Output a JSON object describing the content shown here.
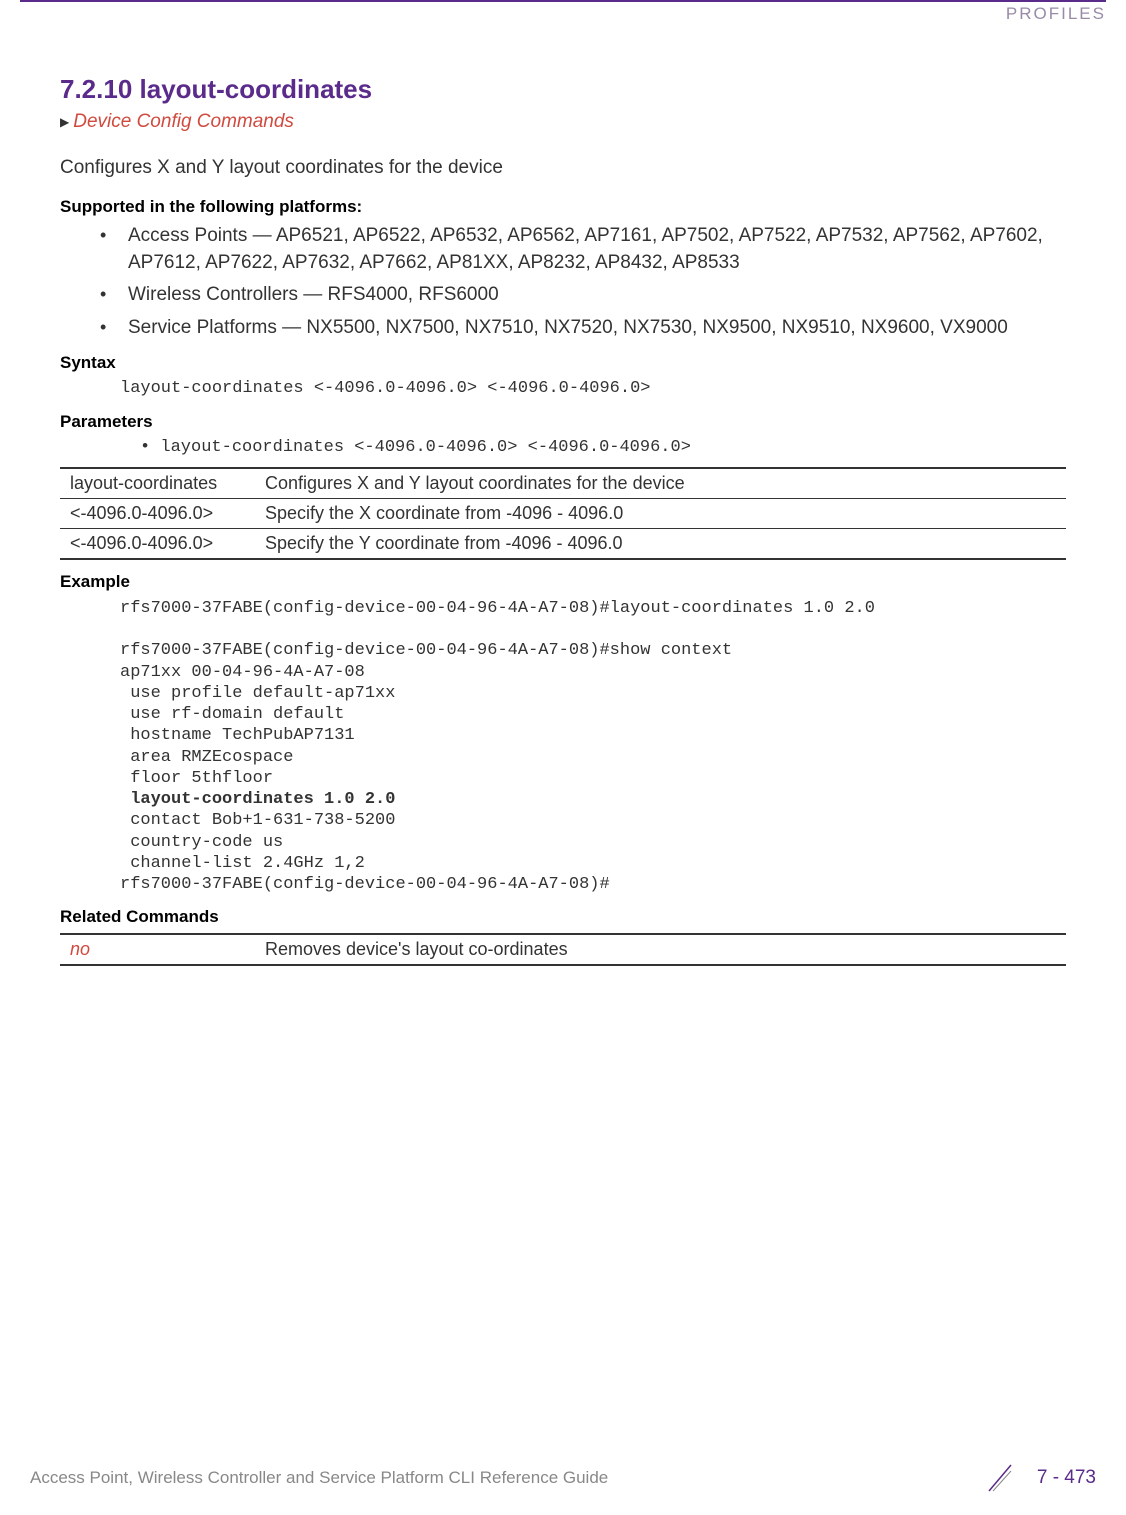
{
  "header": {
    "label": "PROFILES"
  },
  "section": {
    "heading": "7.2.10 layout-coordinates",
    "breadcrumb": "Device Config Commands",
    "intro": "Configures X and Y layout coordinates for the device"
  },
  "platforms": {
    "heading": "Supported in the following platforms:",
    "items": [
      "Access Points — AP6521, AP6522, AP6532, AP6562, AP7161, AP7502, AP7522, AP7532, AP7562, AP7602, AP7612, AP7622, AP7632, AP7662, AP81XX, AP8232, AP8432, AP8533",
      "Wireless Controllers — RFS4000, RFS6000",
      "Service Platforms — NX5500, NX7500, NX7510, NX7520, NX7530, NX9500, NX9510, NX9600, VX9000"
    ]
  },
  "syntax": {
    "heading": "Syntax",
    "code": "layout-coordinates <-4096.0-4096.0> <-4096.0-4096.0>"
  },
  "parameters": {
    "heading": "Parameters",
    "bullet": "• layout-coordinates <-4096.0-4096.0> <-4096.0-4096.0>",
    "rows": [
      {
        "name": "layout-coordinates",
        "desc": "Configures X and Y layout coordinates for the device"
      },
      {
        "name": "<-4096.0-4096.0>",
        "desc": "Specify the X coordinate from -4096 - 4096.0"
      },
      {
        "name": "<-4096.0-4096.0>",
        "desc": "Specify the Y coordinate from -4096 - 4096.0"
      }
    ]
  },
  "example": {
    "heading": "Example",
    "line1": "rfs7000-37FABE(config-device-00-04-96-4A-A7-08)#layout-coordinates 1.0 2.0",
    "line2": "rfs7000-37FABE(config-device-00-04-96-4A-A7-08)#show context",
    "line3": "ap71xx 00-04-96-4A-A7-08",
    "line4": " use profile default-ap71xx",
    "line5": " use rf-domain default",
    "line6": " hostname TechPubAP7131",
    "line7": " area RMZEcospace",
    "line8": " floor 5thfloor",
    "line9": " layout-coordinates 1.0 2.0",
    "line10": " contact Bob+1-631-738-5200",
    "line11": " country-code us",
    "line12": " channel-list 2.4GHz 1,2",
    "line13": "rfs7000-37FABE(config-device-00-04-96-4A-A7-08)#"
  },
  "related": {
    "heading": "Related Commands",
    "rows": [
      {
        "cmd": "no",
        "desc": "Removes device's layout co-ordinates"
      }
    ]
  },
  "footer": {
    "title": "Access Point, Wireless Controller and Service Platform CLI Reference Guide",
    "page": "7 - 473"
  }
}
